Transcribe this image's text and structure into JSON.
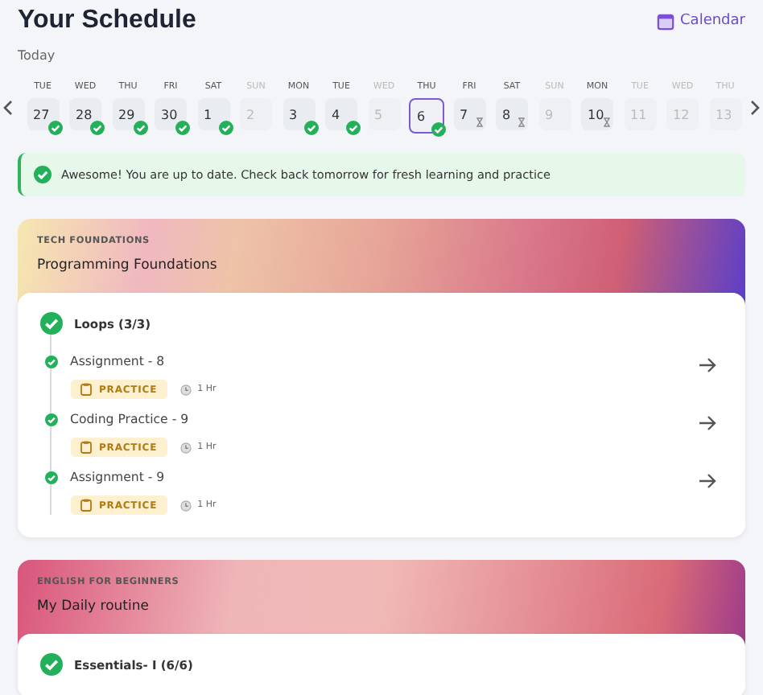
{
  "header": {
    "title": "Your Schedule",
    "calendar_link": "Calendar",
    "subtitle": "Today"
  },
  "days": [
    {
      "day": "TUE",
      "date": "27",
      "kind": "done",
      "selected": false
    },
    {
      "day": "WED",
      "date": "28",
      "kind": "done",
      "selected": false
    },
    {
      "day": "THU",
      "date": "29",
      "kind": "done",
      "selected": false
    },
    {
      "day": "FRI",
      "date": "30",
      "kind": "done",
      "selected": false
    },
    {
      "day": "SAT",
      "date": "1",
      "kind": "done",
      "selected": false
    },
    {
      "day": "SUN",
      "date": "2",
      "kind": "off",
      "selected": false
    },
    {
      "day": "MON",
      "date": "3",
      "kind": "done",
      "selected": false
    },
    {
      "day": "TUE",
      "date": "4",
      "kind": "done",
      "selected": false
    },
    {
      "day": "WED",
      "date": "5",
      "kind": "off",
      "selected": false
    },
    {
      "day": "THU",
      "date": "6",
      "kind": "done",
      "selected": true
    },
    {
      "day": "FRI",
      "date": "7",
      "kind": "pending",
      "selected": false
    },
    {
      "day": "SAT",
      "date": "8",
      "kind": "pending",
      "selected": false
    },
    {
      "day": "SUN",
      "date": "9",
      "kind": "off",
      "selected": false
    },
    {
      "day": "MON",
      "date": "10",
      "kind": "pending",
      "selected": false
    },
    {
      "day": "TUE",
      "date": "11",
      "kind": "off",
      "selected": false
    },
    {
      "day": "WED",
      "date": "12",
      "kind": "off",
      "selected": false
    },
    {
      "day": "THU",
      "date": "13",
      "kind": "off",
      "selected": false
    }
  ],
  "banner": "Awesome! You are up to date. Check back tomorrow for fresh learning and practice",
  "courses": [
    {
      "category": "TECH FOUNDATIONS",
      "title": "Programming Foundations",
      "color": "#d9778a",
      "module": {
        "title": "Loops (3/3)",
        "done": true,
        "items": [
          {
            "title": "Assignment - 8",
            "tag": "PRACTICE",
            "duration": "1 Hr",
            "done": true
          },
          {
            "title": "Coding Practice - 9",
            "tag": "PRACTICE",
            "duration": "1 Hr",
            "done": true
          },
          {
            "title": "Assignment - 9",
            "tag": "PRACTICE",
            "duration": "1 Hr",
            "done": true
          }
        ]
      }
    },
    {
      "category": "ENGLISH FOR BEGINNERS",
      "title": "My Daily routine",
      "color": "#d9557c",
      "module": {
        "title": "Essentials- I (6/6)",
        "done": true
      }
    }
  ]
}
